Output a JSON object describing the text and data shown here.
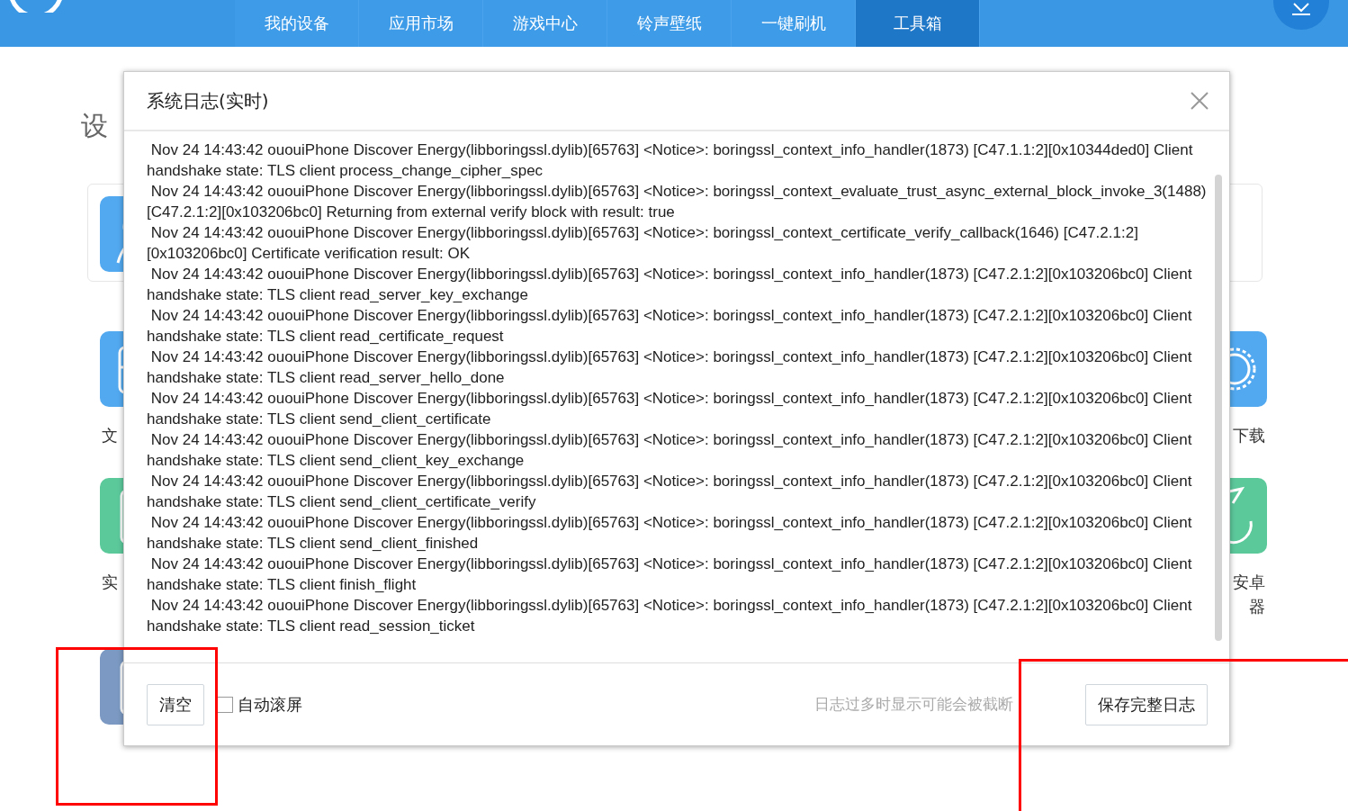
{
  "nav": {
    "tabs": [
      {
        "label": "我的设备",
        "selected": false
      },
      {
        "label": "应用市场",
        "selected": false
      },
      {
        "label": "游戏中心",
        "selected": false
      },
      {
        "label": "铃声壁纸",
        "selected": false
      },
      {
        "label": "一键刷机",
        "selected": false
      },
      {
        "label": "工具箱",
        "selected": true
      }
    ]
  },
  "tools": {
    "heading": "设",
    "rows": [
      {
        "left_label": "文",
        "right_lines": [
          "下载"
        ]
      },
      {
        "left_label": "实",
        "right_lines": [
          "安卓",
          "器"
        ]
      }
    ]
  },
  "dialog": {
    "title": "系统日志(实时)",
    "log_lines": [
      " Nov 24 14:43:42 ououiPhone Discover Energy(libboringssl.dylib)[65763] <Notice>: boringssl_context_info_handler(1873) [C47.1.1:2][0x10344ded0] Client handshake state: TLS client process_change_cipher_spec",
      " Nov 24 14:43:42 ououiPhone Discover Energy(libboringssl.dylib)[65763] <Notice>: boringssl_context_evaluate_trust_async_external_block_invoke_3(1488) [C47.2.1:2][0x103206bc0] Returning from external verify block with result: true",
      " Nov 24 14:43:42 ououiPhone Discover Energy(libboringssl.dylib)[65763] <Notice>: boringssl_context_certificate_verify_callback(1646) [C47.2.1:2][0x103206bc0] Certificate verification result: OK",
      " Nov 24 14:43:42 ououiPhone Discover Energy(libboringssl.dylib)[65763] <Notice>: boringssl_context_info_handler(1873) [C47.2.1:2][0x103206bc0] Client handshake state: TLS client read_server_key_exchange",
      " Nov 24 14:43:42 ououiPhone Discover Energy(libboringssl.dylib)[65763] <Notice>: boringssl_context_info_handler(1873) [C47.2.1:2][0x103206bc0] Client handshake state: TLS client read_certificate_request",
      " Nov 24 14:43:42 ououiPhone Discover Energy(libboringssl.dylib)[65763] <Notice>: boringssl_context_info_handler(1873) [C47.2.1:2][0x103206bc0] Client handshake state: TLS client read_server_hello_done",
      " Nov 24 14:43:42 ououiPhone Discover Energy(libboringssl.dylib)[65763] <Notice>: boringssl_context_info_handler(1873) [C47.2.1:2][0x103206bc0] Client handshake state: TLS client send_client_certificate",
      " Nov 24 14:43:42 ououiPhone Discover Energy(libboringssl.dylib)[65763] <Notice>: boringssl_context_info_handler(1873) [C47.2.1:2][0x103206bc0] Client handshake state: TLS client send_client_key_exchange",
      " Nov 24 14:43:42 ououiPhone Discover Energy(libboringssl.dylib)[65763] <Notice>: boringssl_context_info_handler(1873) [C47.2.1:2][0x103206bc0] Client handshake state: TLS client send_client_certificate_verify",
      " Nov 24 14:43:42 ououiPhone Discover Energy(libboringssl.dylib)[65763] <Notice>: boringssl_context_info_handler(1873) [C47.2.1:2][0x103206bc0] Client handshake state: TLS client send_client_finished",
      " Nov 24 14:43:42 ououiPhone Discover Energy(libboringssl.dylib)[65763] <Notice>: boringssl_context_info_handler(1873) [C47.2.1:2][0x103206bc0] Client handshake state: TLS client finish_flight",
      " Nov 24 14:43:42 ououiPhone Discover Energy(libboringssl.dylib)[65763] <Notice>: boringssl_context_info_handler(1873) [C47.2.1:2][0x103206bc0] Client handshake state: TLS client read_session_ticket"
    ],
    "clear_button": "清空",
    "auto_scroll": {
      "label": "自动滚屏",
      "checked": false
    },
    "hint": "日志过多时显示可能会被截断",
    "save_button": "保存完整日志"
  }
}
